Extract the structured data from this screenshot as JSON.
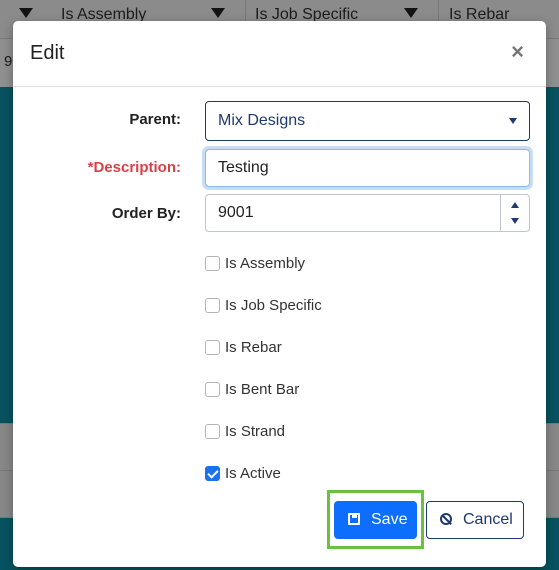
{
  "background": {
    "columns": [
      "Is Assembly",
      "Is Job Specific",
      "Is Rebar"
    ],
    "row_fragment": "9"
  },
  "modal": {
    "title": "Edit",
    "close_glyph": "×",
    "fields": {
      "parent_label": "Parent:",
      "parent_value": "Mix Designs",
      "description_label": "*Description:",
      "description_value": "Testing",
      "order_by_label": "Order By:",
      "order_by_value": "9001"
    },
    "checkboxes": [
      {
        "label": "Is Assembly",
        "checked": false
      },
      {
        "label": "Is Job Specific",
        "checked": false
      },
      {
        "label": "Is Rebar",
        "checked": false
      },
      {
        "label": "Is Bent Bar",
        "checked": false
      },
      {
        "label": "Is Strand",
        "checked": false
      },
      {
        "label": "Is Active",
        "checked": true
      }
    ],
    "buttons": {
      "save_label": "Save",
      "cancel_label": "Cancel"
    }
  },
  "colors": {
    "primary": "#0d6efd",
    "required": "#d9414a",
    "highlight": "#6dbf3f",
    "teal_background": "#0d8ea6"
  }
}
